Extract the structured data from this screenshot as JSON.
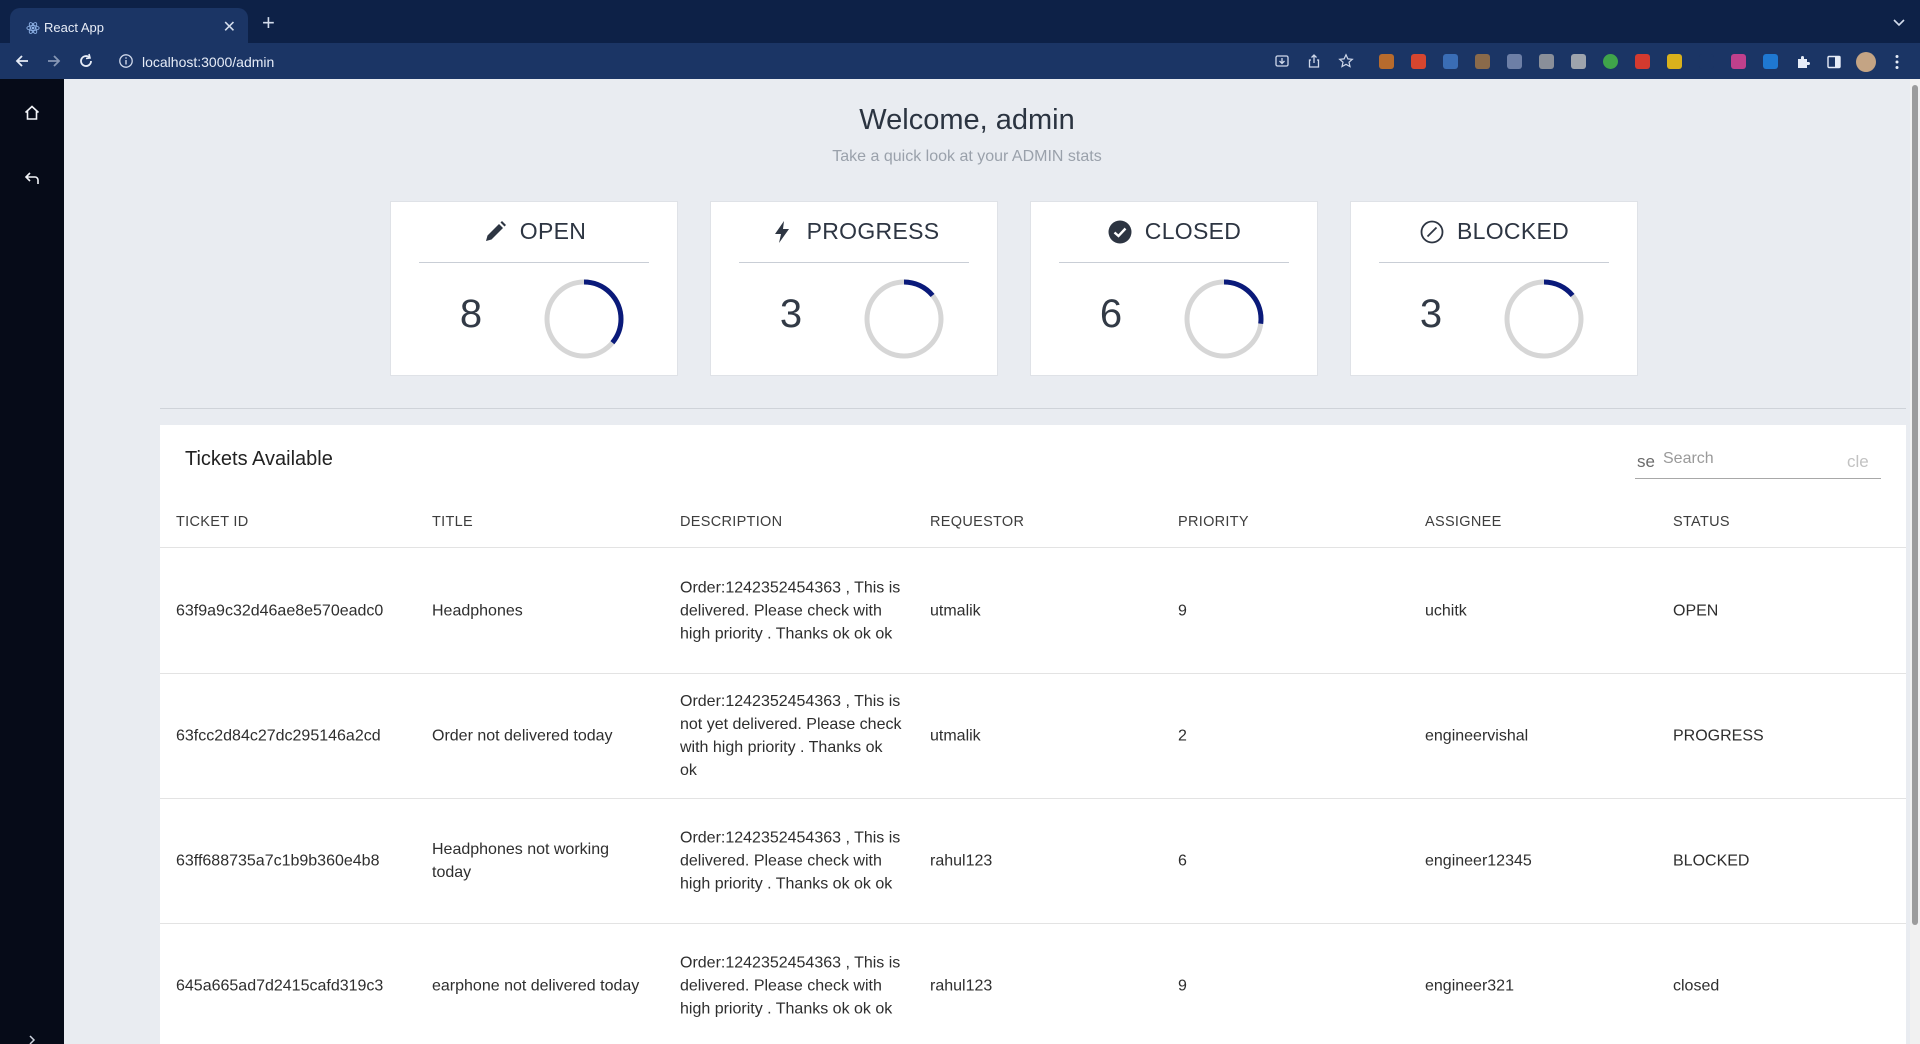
{
  "browser": {
    "tab_title": "React App",
    "url": "localhost:3000/admin"
  },
  "header": {
    "welcome": "Welcome, admin",
    "subtitle": "Take a quick look at your ADMIN stats"
  },
  "stats": [
    {
      "label": "OPEN",
      "count": "8",
      "icon": "pencil-icon",
      "progress": 0.36
    },
    {
      "label": "PROGRESS",
      "count": "3",
      "icon": "bolt-icon",
      "progress": 0.14
    },
    {
      "label": "CLOSED",
      "count": "6",
      "icon": "check-circle-icon",
      "progress": 0.27
    },
    {
      "label": "BLOCKED",
      "count": "3",
      "icon": "blocked-icon",
      "progress": 0.14
    }
  ],
  "colors": {
    "ring_active": "#0a1a7a",
    "ring_track": "#d6d6d6",
    "sidebar": "#060b18",
    "browser_frame": "#0d2147"
  },
  "tickets": {
    "title": "Tickets Available",
    "search_prefix": "se",
    "search_placeholder": "Search",
    "search_suffix": "cle",
    "columns": [
      "TICKET ID",
      "TITLE",
      "DESCRIPTION",
      "REQUESTOR",
      "PRIORITY",
      "ASSIGNEE",
      "STATUS"
    ],
    "rows": [
      {
        "id": "63f9a9c32d46ae8e570eadc0",
        "title": "Headphones",
        "description": "Order:1242352454363 , This is delivered. Please check with high priority . Thanks ok ok ok",
        "requestor": "utmalik",
        "priority": "9",
        "assignee": "uchitk",
        "status": "OPEN"
      },
      {
        "id": "63fcc2d84c27dc295146a2cd",
        "title": "Order not delivered today",
        "description": "Order:1242352454363 , This is not yet delivered. Please check with high priority . Thanks ok ok",
        "requestor": "utmalik",
        "priority": "2",
        "assignee": "engineervishal",
        "status": "PROGRESS"
      },
      {
        "id": "63ff688735a7c1b9b360e4b8",
        "title": "Headphones not working today",
        "description": "Order:1242352454363 , This is delivered. Please check with high priority . Thanks ok ok ok",
        "requestor": "rahul123",
        "priority": "6",
        "assignee": "engineer12345",
        "status": "BLOCKED"
      },
      {
        "id": "645a665ad7d2415cafd319c3",
        "title": "earphone not delivered today",
        "description": "Order:1242352454363 , This is delivered. Please check with high priority . Thanks ok ok ok",
        "requestor": "rahul123",
        "priority": "9",
        "assignee": "engineer321",
        "status": "closed"
      }
    ]
  }
}
